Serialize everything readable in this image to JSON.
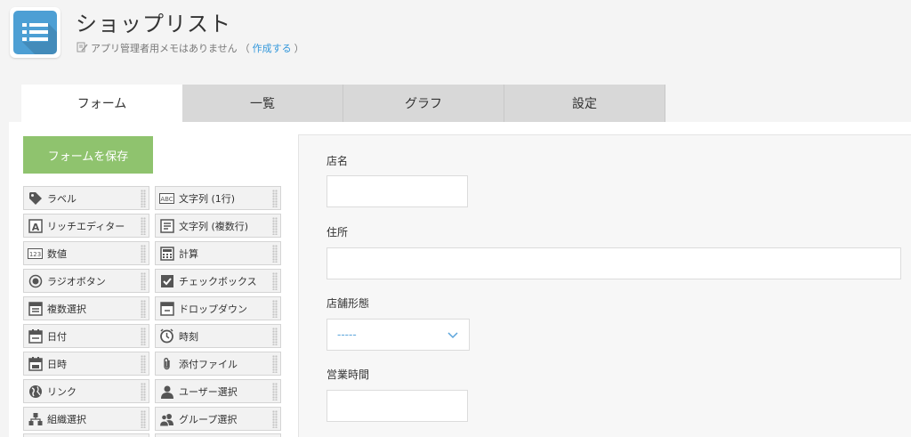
{
  "app": {
    "title": "ショップリスト",
    "memo_text": "アプリ管理者用メモはありません",
    "memo_paren_open": "（",
    "memo_link": "作成する",
    "memo_paren_close": "）",
    "icon": "list-icon"
  },
  "tabs": [
    {
      "label": "フォーム",
      "active": true
    },
    {
      "label": "一覧",
      "active": false
    },
    {
      "label": "グラフ",
      "active": false
    },
    {
      "label": "設定",
      "active": false
    }
  ],
  "palette": {
    "save_label": "フォームを保存",
    "items": [
      {
        "label": "ラベル",
        "icon": "tag-icon"
      },
      {
        "label": "文字列 (1行)",
        "icon": "abc-icon"
      },
      {
        "label": "リッチエディター",
        "icon": "rich-editor-icon"
      },
      {
        "label": "文字列 (複数行)",
        "icon": "multiline-text-icon"
      },
      {
        "label": "数値",
        "icon": "number-icon"
      },
      {
        "label": "計算",
        "icon": "calculator-icon"
      },
      {
        "label": "ラジオボタン",
        "icon": "radio-icon"
      },
      {
        "label": "チェックボックス",
        "icon": "checkbox-icon"
      },
      {
        "label": "複数選択",
        "icon": "multi-select-icon"
      },
      {
        "label": "ドロップダウン",
        "icon": "dropdown-icon"
      },
      {
        "label": "日付",
        "icon": "calendar-icon"
      },
      {
        "label": "時刻",
        "icon": "clock-icon"
      },
      {
        "label": "日時",
        "icon": "datetime-icon"
      },
      {
        "label": "添付ファイル",
        "icon": "paperclip-icon"
      },
      {
        "label": "リンク",
        "icon": "globe-icon"
      },
      {
        "label": "ユーザー選択",
        "icon": "user-icon"
      },
      {
        "label": "組織選択",
        "icon": "org-icon"
      },
      {
        "label": "グループ選択",
        "icon": "group-icon"
      }
    ]
  },
  "form": {
    "fields": [
      {
        "label": "店名"
      },
      {
        "label": "住所"
      },
      {
        "label": "店舗形態",
        "select_value": "-----"
      },
      {
        "label": "営業時間"
      }
    ]
  },
  "colors": {
    "accent": "#8fc36e",
    "link": "#3498db",
    "app_icon": "#4d9fd4"
  }
}
